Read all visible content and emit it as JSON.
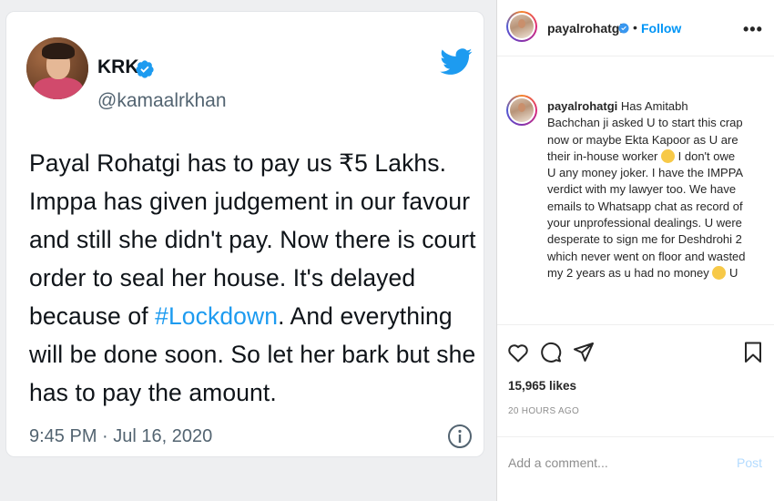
{
  "tweet": {
    "name": "KRK",
    "handle": "@kamaalrkhan",
    "text_lines": [
      "Payal Rohatgi has to pay us ₹5 Lakhs.",
      "Imppa has given judgement in our favour",
      "and still she didn't pay. Now there is court",
      "order to seal her house. It's delayed",
      "because of ",
      ". And everything",
      "will be done soon. So let her bark but she",
      "has to pay the amount."
    ],
    "hashtag": "#Lockdown",
    "timestamp": "9:45 PM · Jul 16, 2020",
    "icons": {
      "verified": "verified-badge-icon",
      "brand": "twitter-bird-icon",
      "info": "info-icon"
    },
    "colors": {
      "brand": "#1d9bf0",
      "text": "#0f1419",
      "muted": "#536471"
    }
  },
  "instagram": {
    "header": {
      "username": "payalrohatgi",
      "dot": "•",
      "follow_label": "Follow",
      "more_label": "•••"
    },
    "caption": {
      "username": "payalrohatgi",
      "lines": [
        "Has Amitabh",
        "Bachchan ji asked U to start this crap",
        "now or maybe Ekta Kapoor as U are",
        "their in-house worker",
        "I don't owe",
        "U any money joker. I have the IMPPA",
        "verdict with my lawyer too. We have",
        "emails to Whatsapp chat as record of",
        "your unprofessional dealings. U were",
        "desperate to sign me for Deshdrohi 2",
        "which never went on floor and wasted",
        "my 2 years as u had no money",
        "U"
      ]
    },
    "likes": "15,965 likes",
    "time": "20 HOURS AGO",
    "comment_placeholder": "Add a comment...",
    "post_label": "Post",
    "icons": {
      "like": "heart-icon",
      "comment": "comment-icon",
      "share": "share-icon",
      "save": "bookmark-icon"
    },
    "colors": {
      "accent": "#0095f6",
      "text": "#262626",
      "muted": "#8e8e8e"
    }
  }
}
